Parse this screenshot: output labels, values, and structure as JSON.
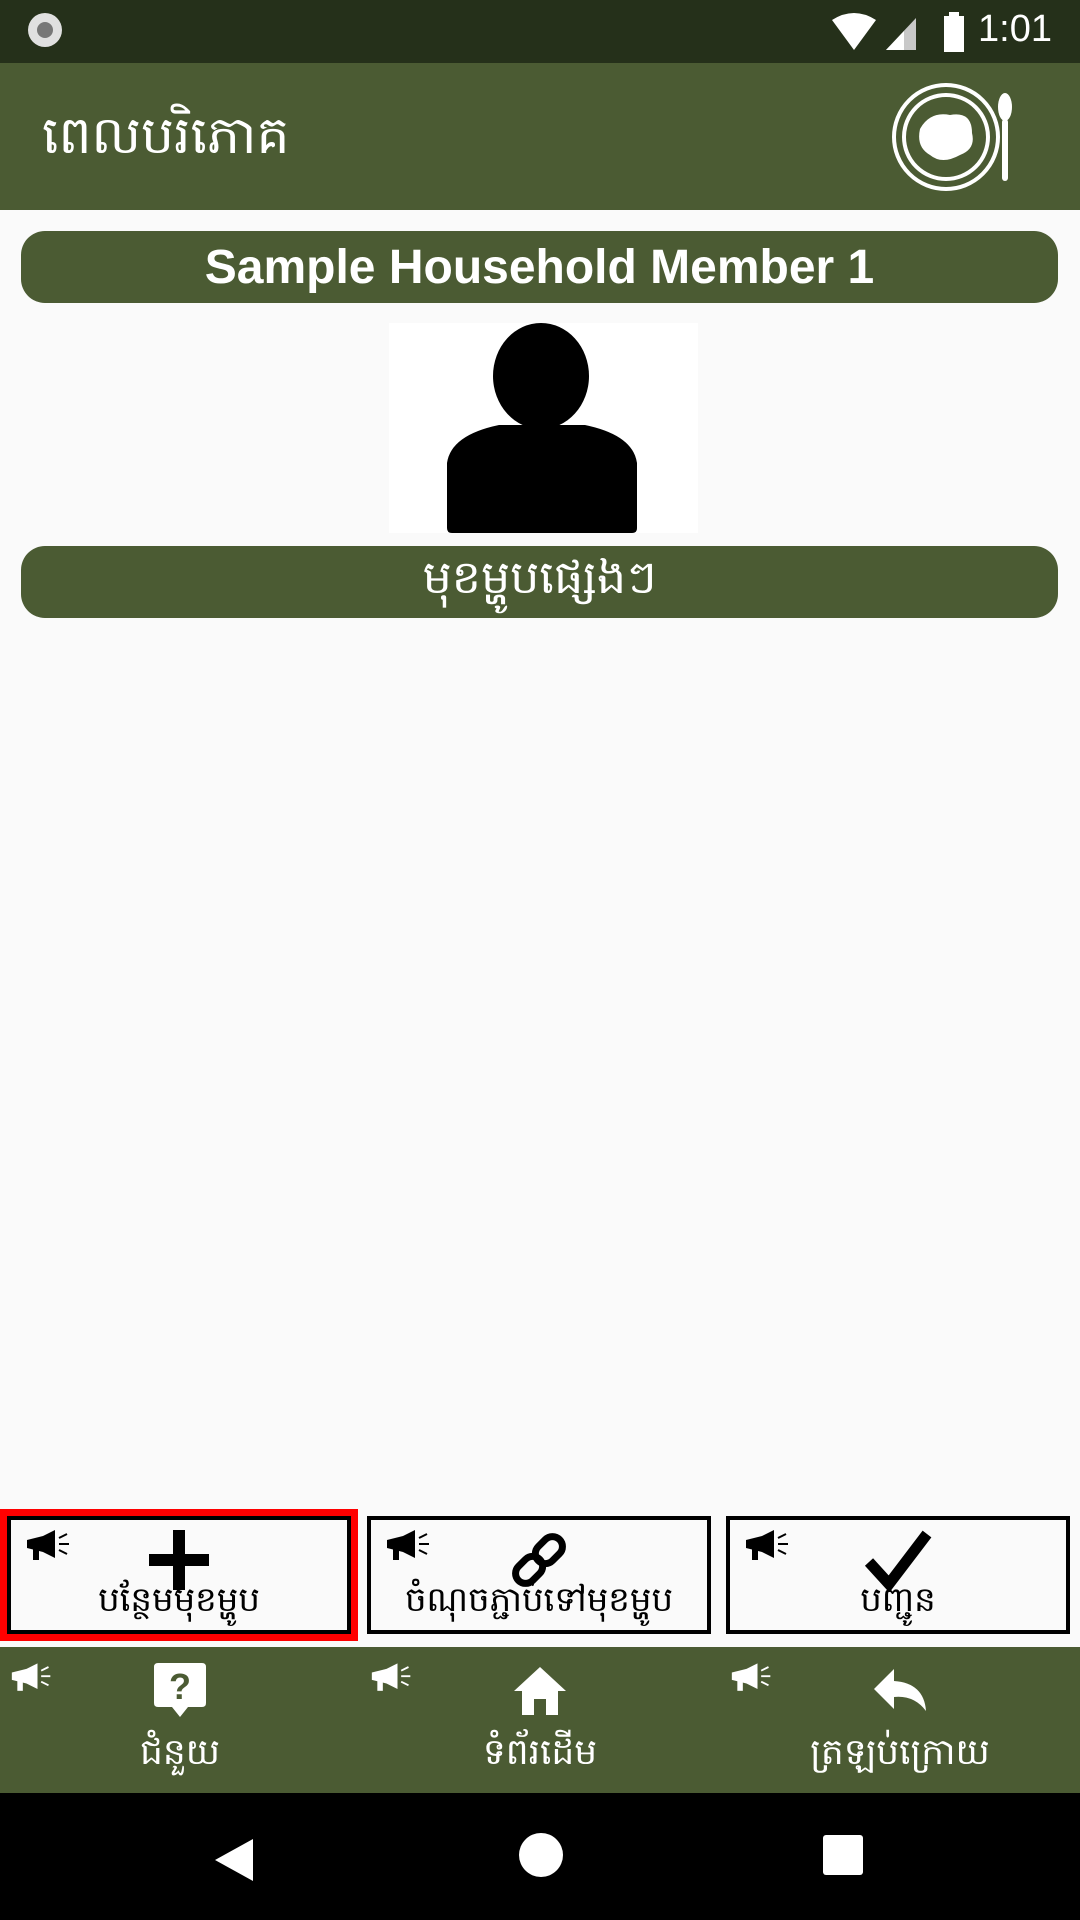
{
  "status_bar": {
    "time": "1:01"
  },
  "app_bar": {
    "title": "ពេលបរិភោគ"
  },
  "member": {
    "name": "Sample Household Member 1"
  },
  "category": {
    "label": "មុខម្ហូបផ្សេងៗ"
  },
  "actions": [
    {
      "label": "បន្ថែមមុខម្ហូប",
      "icon": "plus-icon"
    },
    {
      "label": "ចំណុចភ្ជាប់ទៅមុខម្ហូប",
      "icon": "link-icon"
    },
    {
      "label": "បញ្ជូន",
      "icon": "check-icon"
    }
  ],
  "bottom_nav": [
    {
      "label": "ជំនួយ",
      "icon": "help-icon"
    },
    {
      "label": "ទំព័រដើម",
      "icon": "home-icon"
    },
    {
      "label": "ត្រឡប់ក្រោយ",
      "icon": "reply-icon"
    }
  ],
  "colors": {
    "primary": "#4b5b33",
    "status_bar": "#25301a",
    "selected_outline": "#ff0000"
  }
}
